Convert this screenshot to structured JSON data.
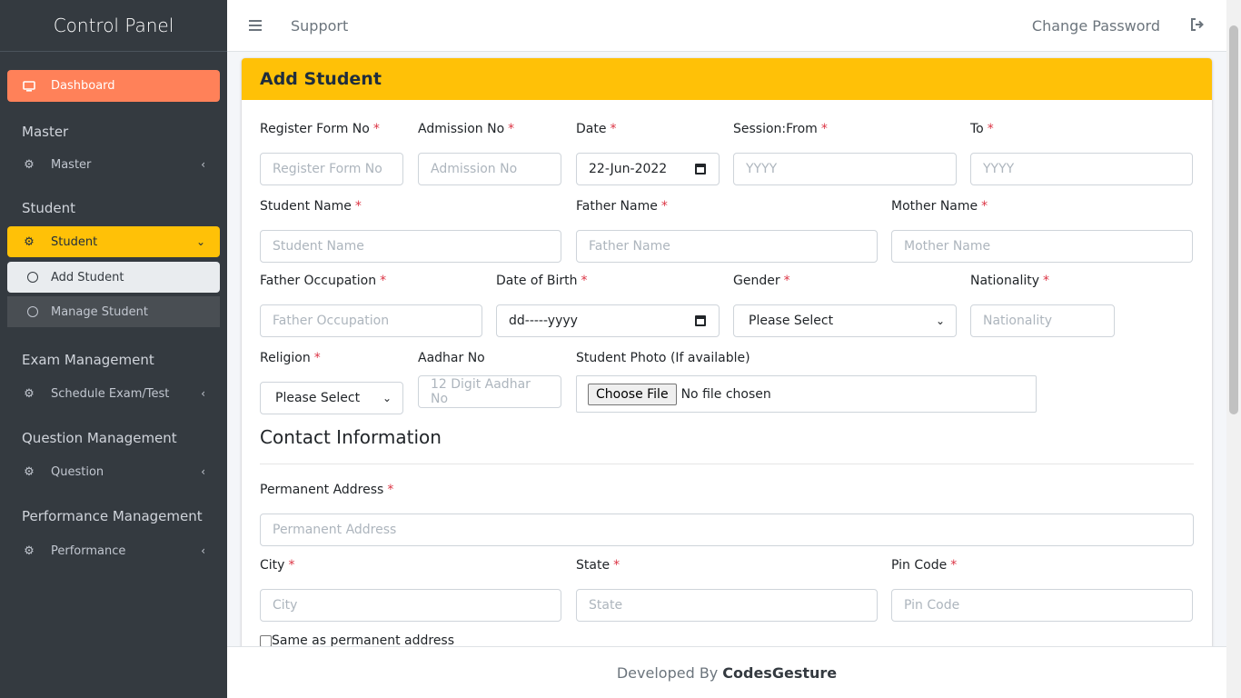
{
  "sidebar": {
    "brand": "Control Panel",
    "dashboard": "Dashboard",
    "sections": {
      "master": {
        "header": "Master",
        "item": "Master"
      },
      "student": {
        "header": "Student",
        "item": "Student",
        "sub": [
          "Add Student",
          "Manage Student"
        ]
      },
      "exam": {
        "header": "Exam Management",
        "item": "Schedule Exam/Test"
      },
      "question": {
        "header": "Question Management",
        "item": "Question"
      },
      "performance": {
        "header": "Performance Management",
        "item": "Performance"
      }
    },
    "accent_dashboard": "#ff8159",
    "accent_active": "#ffc107"
  },
  "topbar": {
    "support": "Support",
    "change_password": "Change Password"
  },
  "form": {
    "title": "Add Student",
    "register_form_no": {
      "label": "Register Form No",
      "placeholder": "Register Form No"
    },
    "admission_no": {
      "label": "Admission No",
      "placeholder": "Admission No"
    },
    "date": {
      "label": "Date",
      "value": "22-Jun-2022"
    },
    "session_from": {
      "label": "Session:From",
      "placeholder": "YYYY"
    },
    "session_to": {
      "label": "To",
      "placeholder": "YYYY"
    },
    "student_name": {
      "label": "Student Name",
      "placeholder": "Student Name"
    },
    "father_name": {
      "label": "Father Name",
      "placeholder": "Father Name"
    },
    "mother_name": {
      "label": "Mother Name",
      "placeholder": "Mother Name"
    },
    "father_occupation": {
      "label": "Father Occupation",
      "placeholder": "Father Occupation"
    },
    "dob": {
      "label": "Date of Birth",
      "value": "dd-----yyyy"
    },
    "gender": {
      "label": "Gender",
      "value": "Please Select"
    },
    "nationality": {
      "label": "Nationality",
      "placeholder": "Nationality"
    },
    "religion": {
      "label": "Religion",
      "value": "Please Select"
    },
    "aadhar": {
      "label": "Aadhar No",
      "placeholder": "12 Digit Aadhar No"
    },
    "photo": {
      "label": "Student Photo (If available)",
      "button": "Choose File",
      "status": "No file chosen"
    },
    "contact_title": "Contact Information",
    "permanent_address": {
      "label": "Permanent Address",
      "placeholder": "Permanent Address"
    },
    "city": {
      "label": "City",
      "placeholder": "City"
    },
    "state": {
      "label": "State",
      "placeholder": "State"
    },
    "pin": {
      "label": "Pin Code",
      "placeholder": "Pin Code"
    },
    "same_as": "Same as permanent address",
    "required_mark": "*"
  },
  "footer": {
    "prefix": "Developed By",
    "brand": "CodesGesture"
  }
}
